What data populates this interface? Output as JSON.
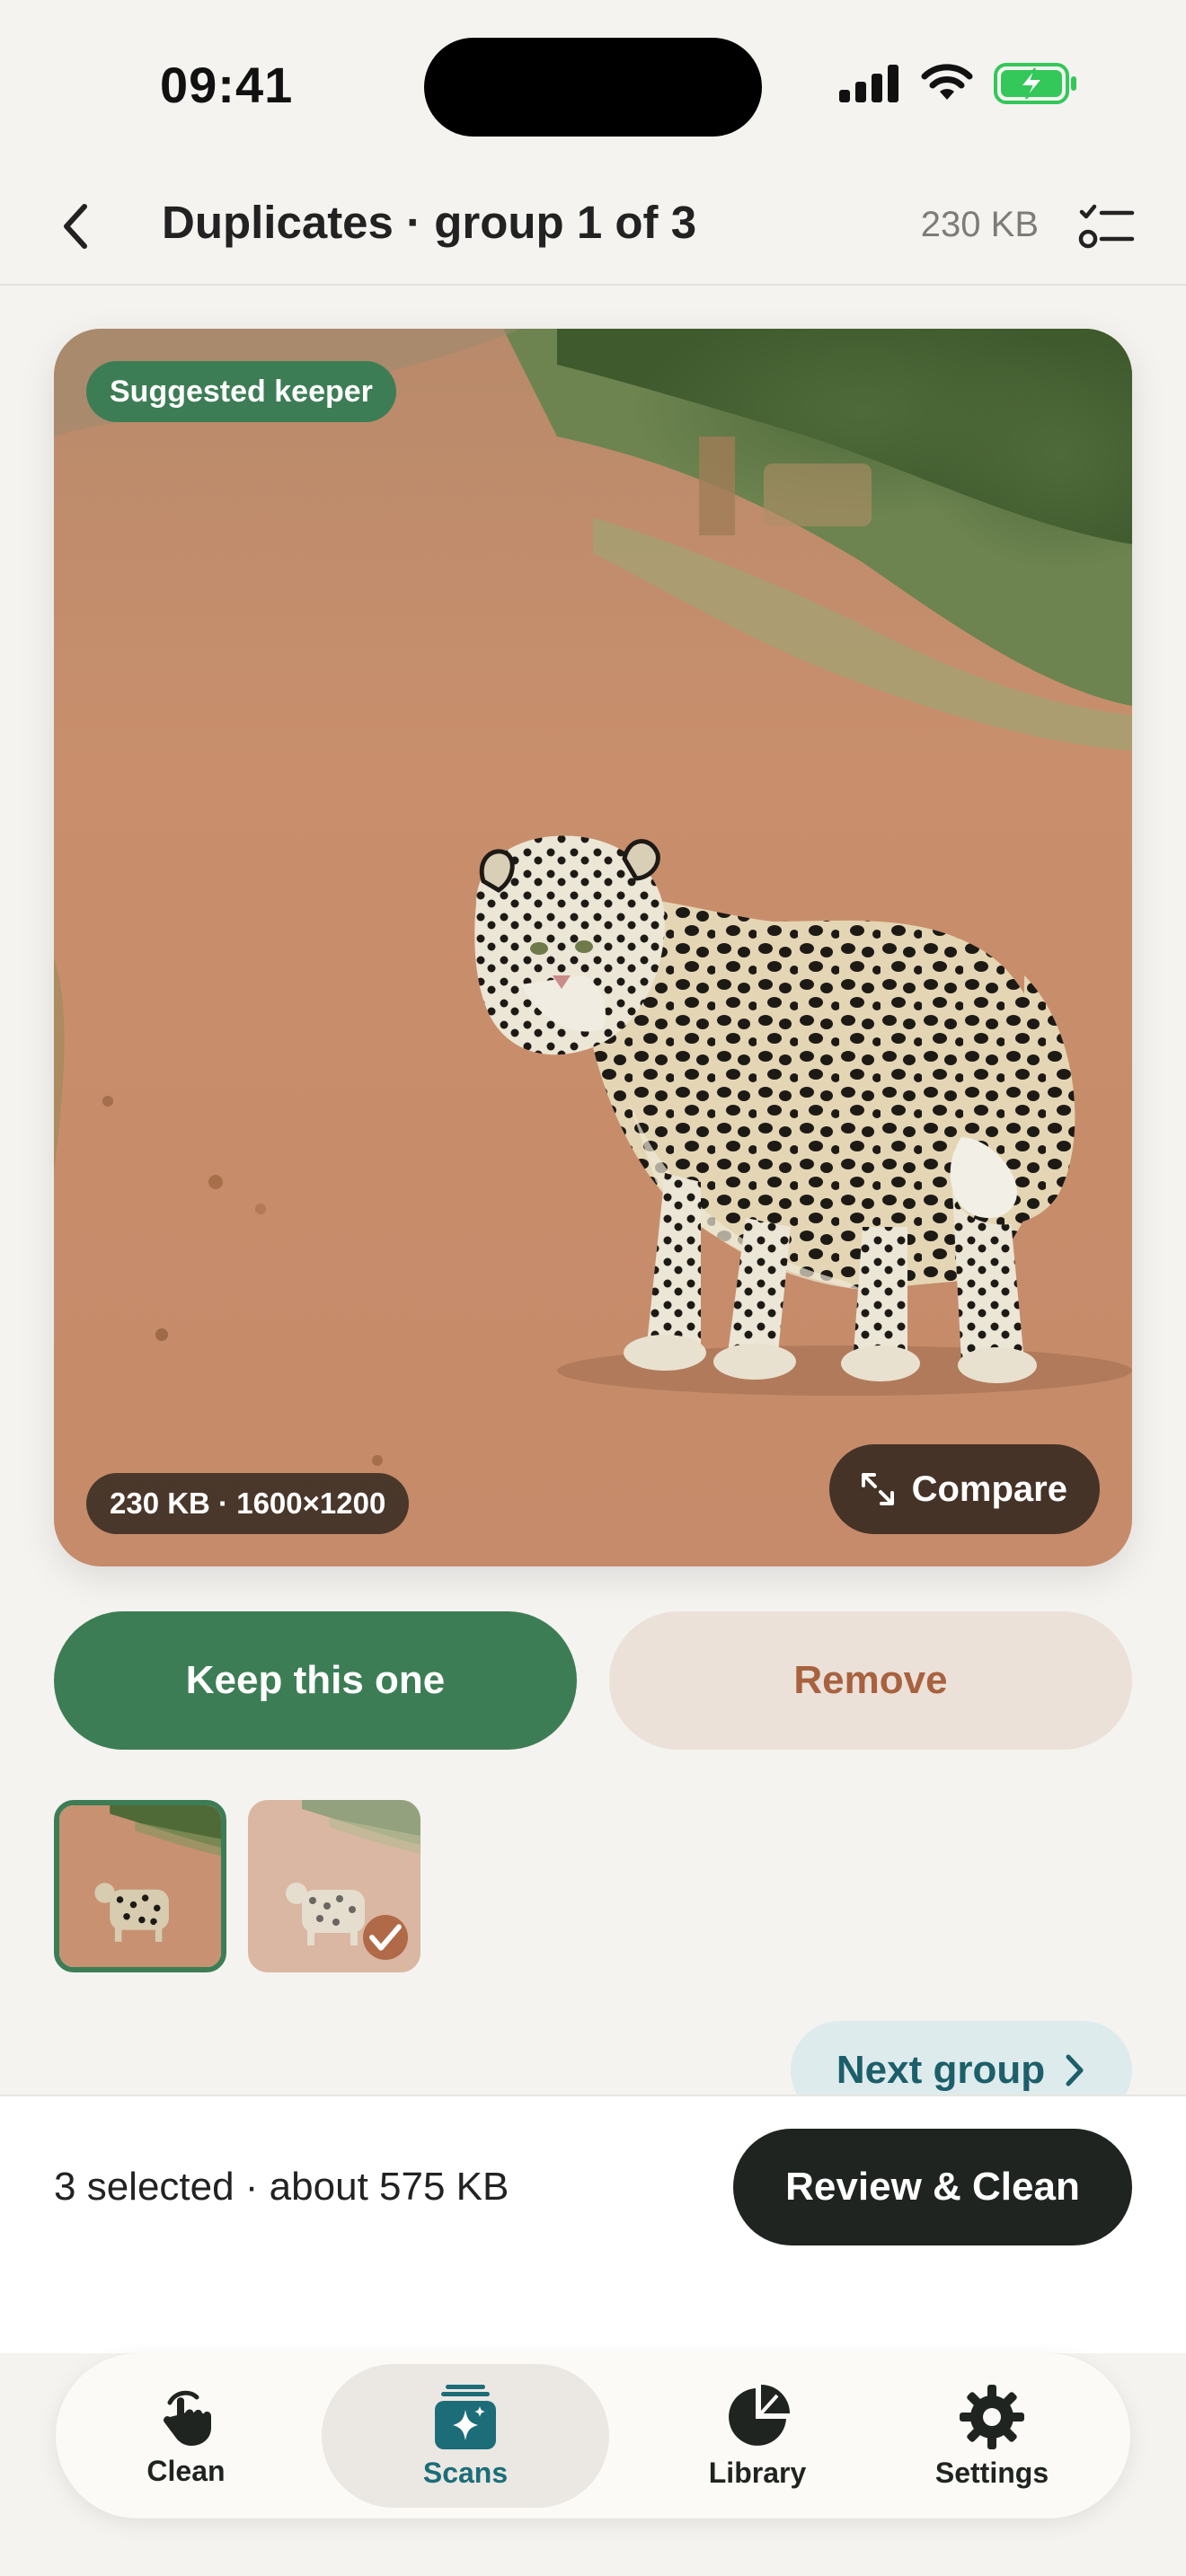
{
  "status_bar": {
    "time": "09:41",
    "icons": [
      "signal-icon",
      "wifi-icon",
      "battery-charging-icon"
    ],
    "battery_color": "#34c759"
  },
  "header": {
    "title": "Duplicates · group 1 of 3",
    "size": "230 KB",
    "back_icon": "chevron-left-icon",
    "select_icon": "checklist-icon"
  },
  "photo": {
    "badge": "Suggested keeper",
    "meta": "230 KB · 1600×1200",
    "compare_label": "Compare",
    "compare_icon": "expand-arrows-icon"
  },
  "actions": {
    "keep_label": "Keep this one",
    "remove_label": "Remove"
  },
  "thumbnails": [
    {
      "state": "keeper",
      "checked": false
    },
    {
      "state": "remove",
      "checked": true
    }
  ],
  "next_group_label": "Next group",
  "selection": {
    "summary": "3 selected · about 575 KB",
    "review_label": "Review & Clean"
  },
  "tabs": [
    {
      "label": "Clean",
      "icon": "hand-tap-icon",
      "active": false
    },
    {
      "label": "Scans",
      "icon": "scans-sparkle-icon",
      "active": true
    },
    {
      "label": "Library",
      "icon": "pie-chart-icon",
      "active": false
    },
    {
      "label": "Settings",
      "icon": "gear-icon",
      "active": false
    }
  ],
  "colors": {
    "accent_green": "#3d7d55",
    "remove_tint": "#ece1d9",
    "remove_text": "#a8623f",
    "teal": "#1c6d78",
    "dark": "#1f2421"
  }
}
